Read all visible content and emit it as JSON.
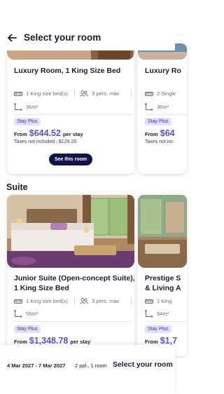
{
  "header": {
    "title": "Select your room",
    "back_icon": "arrow-left-icon"
  },
  "section_title": "Suite",
  "colors": {
    "accent": "#5a4fd6",
    "button": "#12124a",
    "badge_bg": "#e2e0fb",
    "badge_text": "#3a36a6"
  },
  "cards": [
    {
      "name": "Luxury Room, 1 King Size Bed",
      "bed": "1 King size bed(s)",
      "guests": "3 pers. max",
      "size": "36m²",
      "badge": "Stay Plus",
      "from": "From",
      "price": "$644.52",
      "per": "per stay",
      "taxes": "Taxes not included : $128.26.",
      "button": "See this room"
    },
    {
      "name": "Luxury Ro",
      "bed": "2 Single",
      "size": "36m²",
      "badge": "Stay Plus",
      "from": "From",
      "price": "$64",
      "taxes": "Taxes not inc"
    },
    {
      "name_line1": "Junior Suite (Open-concept Suite),",
      "name_line2": "1 King Size Bed",
      "bed": "1 King size bed(s)",
      "guests": "3 pers. max",
      "size": "55m²",
      "badge": "Stay Plus",
      "from": "From",
      "price": "$1,348.78",
      "per": "per stay"
    },
    {
      "name_line1": "Prestige S",
      "name_line2": "& Living A",
      "bed": "1 King",
      "size": "64m²",
      "badge": "Stay Plus",
      "from": "From",
      "price": "$1,7"
    }
  ],
  "footer": {
    "dates": "4 Mar 2027 - 7 Mar 2027",
    "guests": "2 ppl., 1 room",
    "cta": "Select your room"
  }
}
